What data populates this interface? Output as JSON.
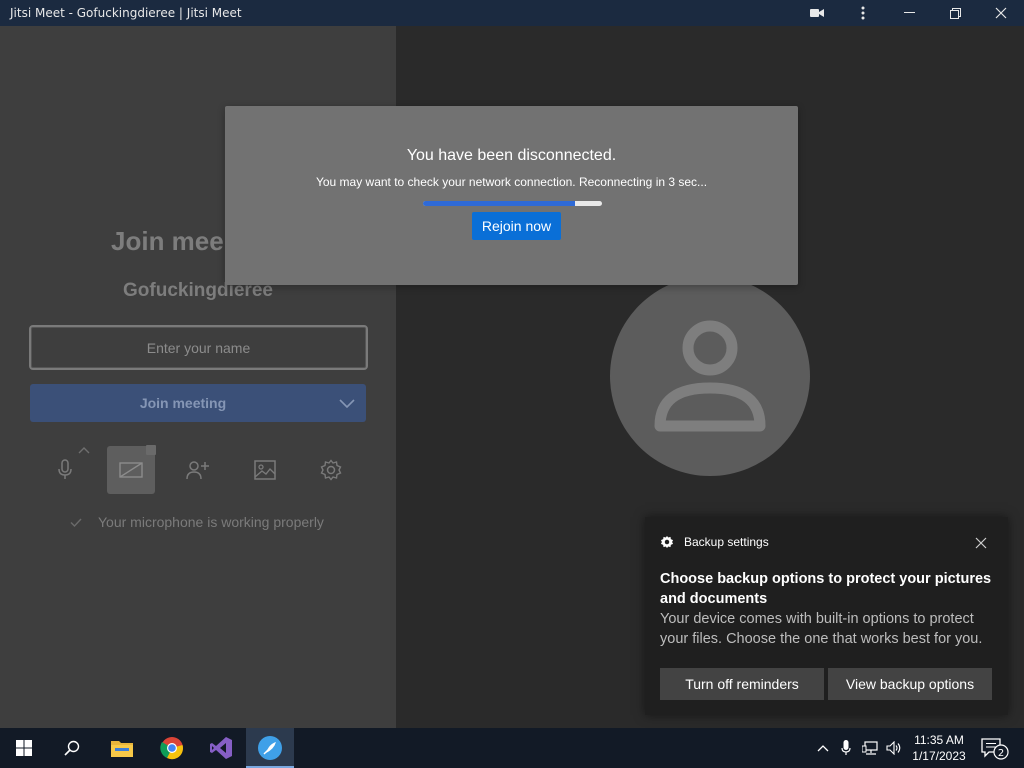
{
  "window": {
    "title": "Jitsi Meet - Gofuckingdieree | Jitsi Meet",
    "icons": [
      "video-camera-icon",
      "kebab-menu-icon",
      "minimize-icon",
      "restore-icon",
      "close-icon"
    ]
  },
  "prejoin": {
    "heading": "Join mee",
    "room_name": "Gofuckingdieree",
    "name_placeholder": "Enter your name",
    "join_label": "Join meeting",
    "toolbar_icons": [
      "microphone-icon",
      "camera-off-icon",
      "invite-person-icon",
      "background-image-icon",
      "settings-gear-icon"
    ],
    "mic_status": "Your microphone is working properly"
  },
  "dialog": {
    "title": "You have been disconnected.",
    "message": "You may want to check your network connection. Reconnecting in 3 sec...",
    "progress_fraction": 0.85,
    "rejoin_label": "Rejoin now"
  },
  "notification": {
    "app": "Backup settings",
    "title": "Choose backup options to protect your pictures and documents",
    "body": "Your device comes with built-in options to protect your files. Choose the one that works best for you.",
    "button_off": "Turn off reminders",
    "button_view": "View backup options"
  },
  "taskbar": {
    "apps": [
      "windows-start-icon",
      "search-icon",
      "file-explorer-icon",
      "chrome-icon",
      "visual-studio-icon",
      "jitsi-meet-icon"
    ],
    "time": "11:35 AM",
    "date": "1/17/2023",
    "notification_count": "2"
  },
  "colors": {
    "accent": "#0a6fd7",
    "join_button": "#3b5078",
    "titlebar": "#1b2a40",
    "taskbar": "#121a26"
  }
}
